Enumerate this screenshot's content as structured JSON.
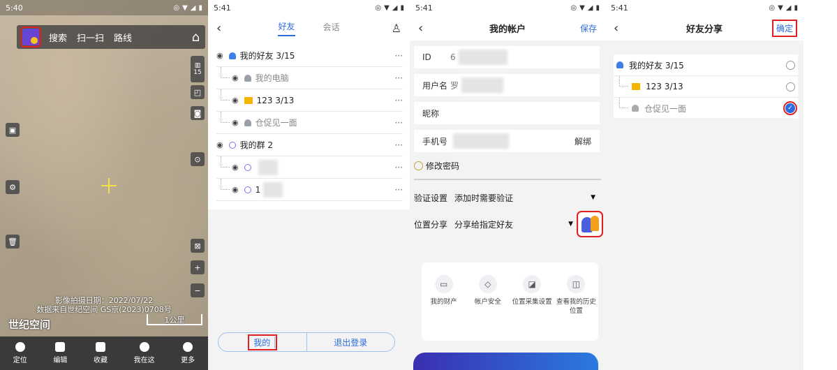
{
  "screens": [
    {
      "status_time": "5:40",
      "toolbar": {
        "search": "搜索",
        "scan": "扫一扫",
        "route": "路线"
      },
      "date_line1": "影像拍摄日期：2022/07/22",
      "date_line2": "数据来自世纪空间 GS京(2023)0708号",
      "brand": "世纪空间",
      "scale": "1公里",
      "zoom_level": "15",
      "bottom_nav": [
        "定位",
        "编辑",
        "收藏",
        "我在这",
        "更多"
      ]
    },
    {
      "status_time": "5:41",
      "tabs": [
        "好友",
        "会话"
      ],
      "rows": [
        {
          "label": "我的好友 3/15",
          "level": 0,
          "icon": "user-icon"
        },
        {
          "label": "我的电脑",
          "level": 1,
          "icon": "user-icon",
          "muted": true
        },
        {
          "label": "123 3/13",
          "level": 1,
          "icon": "folder-icon"
        },
        {
          "label": "仓促见一面",
          "level": 1,
          "icon": "user-icon",
          "muted": true
        },
        {
          "label": "我的群 2",
          "level": 0,
          "icon": "group-icon"
        },
        {
          "label": "",
          "level": 1,
          "icon": "group-icon"
        },
        {
          "label": "1",
          "level": 1,
          "icon": "group-icon"
        }
      ],
      "more": "···",
      "bottom": {
        "me": "我的",
        "logout": "退出登录"
      }
    },
    {
      "status_time": "5:41",
      "title": "我的帐户",
      "save": "保存",
      "id_label": "ID",
      "id_value": "6",
      "username_label": "用户名",
      "username_value": "罗",
      "nickname_label": "昵称",
      "phone_label": "手机号",
      "unbind": "解绑",
      "change_password": "修改密码",
      "verify_label": "验证设置",
      "verify_value": "添加时需要验证",
      "location_label": "位置分享",
      "location_value": "分享给指定好友",
      "card_items": [
        {
          "label": "我的财产",
          "icon": "wallet-icon"
        },
        {
          "label": "帐户安全",
          "icon": "shield-icon"
        },
        {
          "label": "位置采集设置",
          "icon": "location-collect-icon"
        },
        {
          "label": "查看我的历史位置",
          "icon": "map-history-icon"
        }
      ]
    },
    {
      "status_time": "5:41",
      "title": "好友分享",
      "confirm": "确定",
      "rows": [
        {
          "label": "我的好友 3/15",
          "level": 0,
          "checked": false
        },
        {
          "label": "123 3/13",
          "level": 1,
          "checked": false
        },
        {
          "label": "仓促见一面",
          "level": 1,
          "checked": true
        }
      ]
    }
  ]
}
